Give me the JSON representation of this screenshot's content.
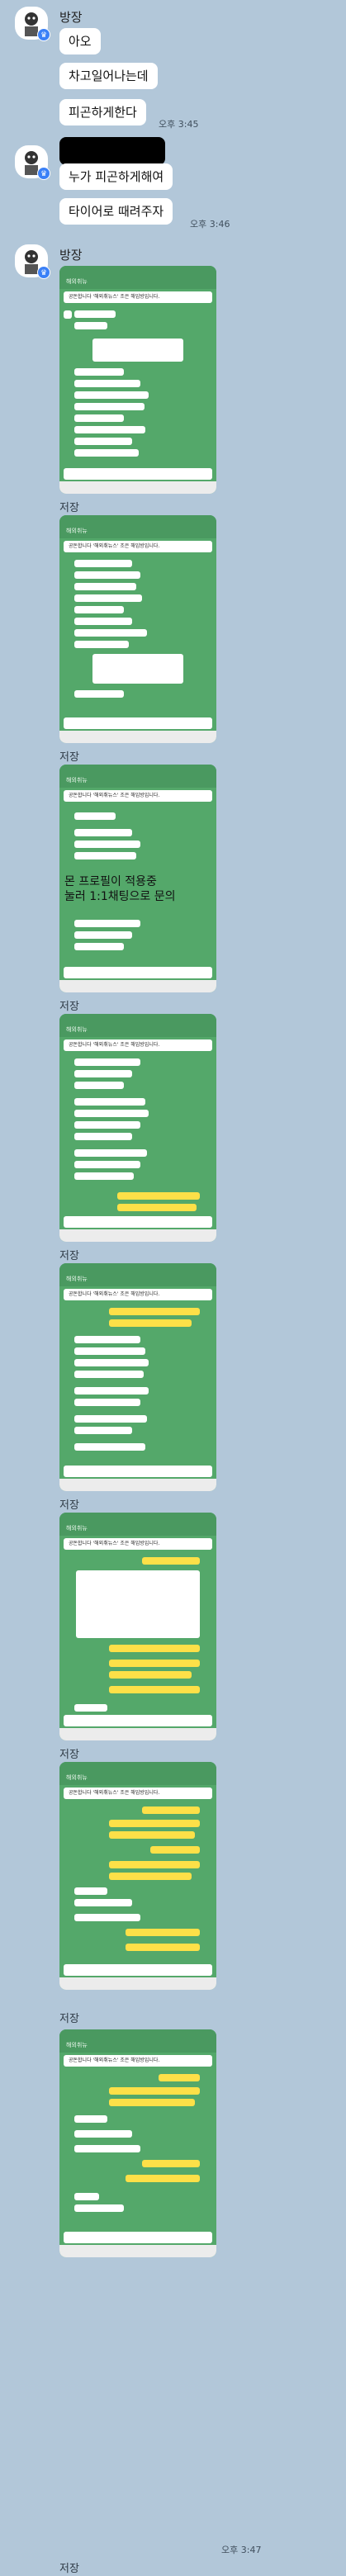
{
  "chat": {
    "sender_name": "방장",
    "messages_1": [
      "아오",
      "차고일어나는데",
      "피곤하게한다"
    ],
    "time_1": "오후 3:45",
    "messages_2": [
      "누가 피곤하게해여",
      "타이어로 때려주자"
    ],
    "time_2": "오후 3:46",
    "shot_header_title": "해외취뉴",
    "shot_notice_text": "공돈합니다 '해외취뉴스' 조은 해임방입니다.",
    "overlay_text_1": "몬 프로필이 적용중",
    "overlay_text_2": "눌러 1:1채팅으로 문의",
    "save_label": "저장",
    "time_last": "오후 3:47"
  },
  "colors": {
    "background": "#b2c7d9",
    "chat_bg_green": "#54a86a",
    "my_bubble": "#fde048",
    "other_bubble": "#ffffff"
  }
}
